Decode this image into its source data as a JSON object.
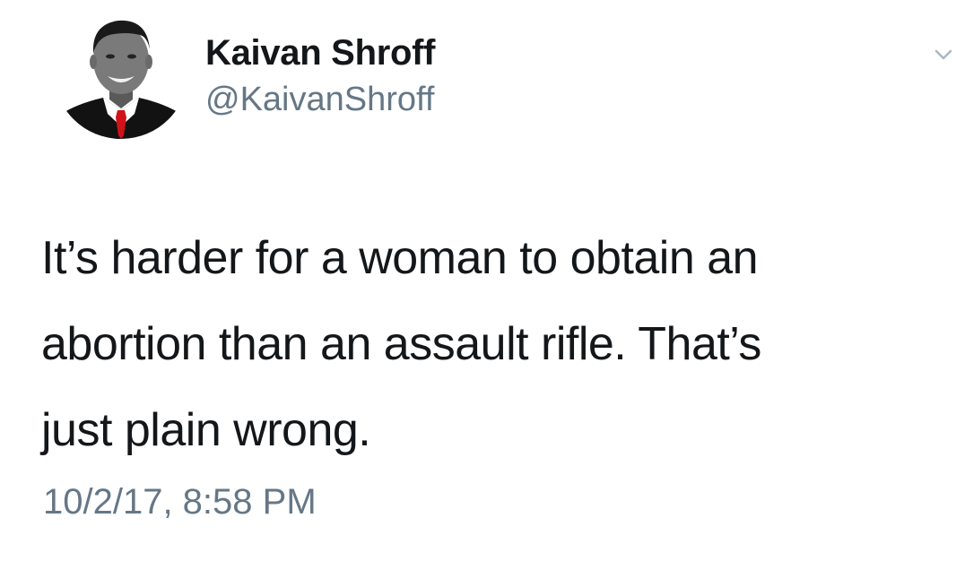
{
  "author": {
    "name": "Kaivan Shroff",
    "handle": "@KaivanShroff"
  },
  "icons": {
    "menu": "chevron-down-icon",
    "avatar": "avatar"
  },
  "tweet": {
    "lines": [
      "It’s harder for a woman to obtain an",
      "abortion than an assault rifle. That’s",
      "just plain wrong."
    ],
    "timestamp": "10/2/17, 8:58 PM"
  },
  "colors": {
    "text": "#14171a",
    "secondary": "#657786",
    "tie": "#d0121b"
  }
}
